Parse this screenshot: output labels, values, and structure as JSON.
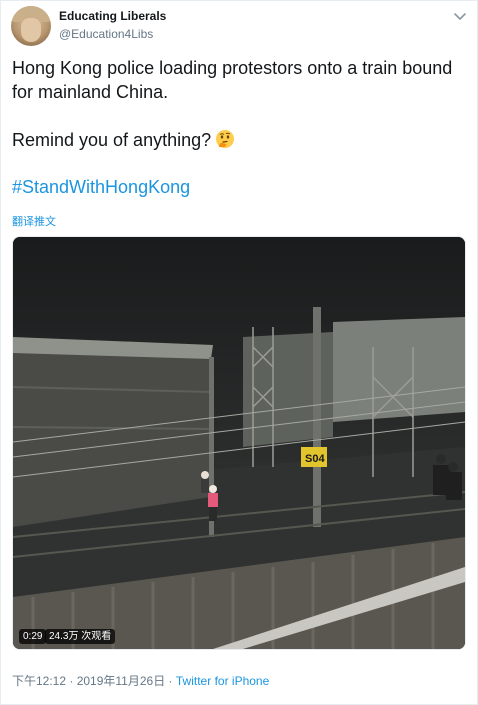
{
  "author": {
    "name": "Educating Liberals",
    "handle": "@Education4Libs"
  },
  "tweet": {
    "line1": "Hong Kong police loading protestors onto a train bound for mainland China.",
    "line2": "Remind you of anything?",
    "emoji_icon": "thinking-face-emoji",
    "hashtag": "#StandWithHongKong",
    "translate_label": "翻译推文"
  },
  "video": {
    "duration": "0:29",
    "views": "24.3万 次观看",
    "sign_text": "S04"
  },
  "meta": {
    "time": "下午12:12",
    "separator1": " · ",
    "date": "2019年11月26日",
    "separator2": " · ",
    "source": "Twitter for iPhone"
  },
  "colors": {
    "link": "#1b95e0",
    "secondary_text": "#657786",
    "primary_text": "#14171a",
    "border": "#e6ecf0"
  },
  "icons": {
    "caret": "chevron-down-icon"
  }
}
